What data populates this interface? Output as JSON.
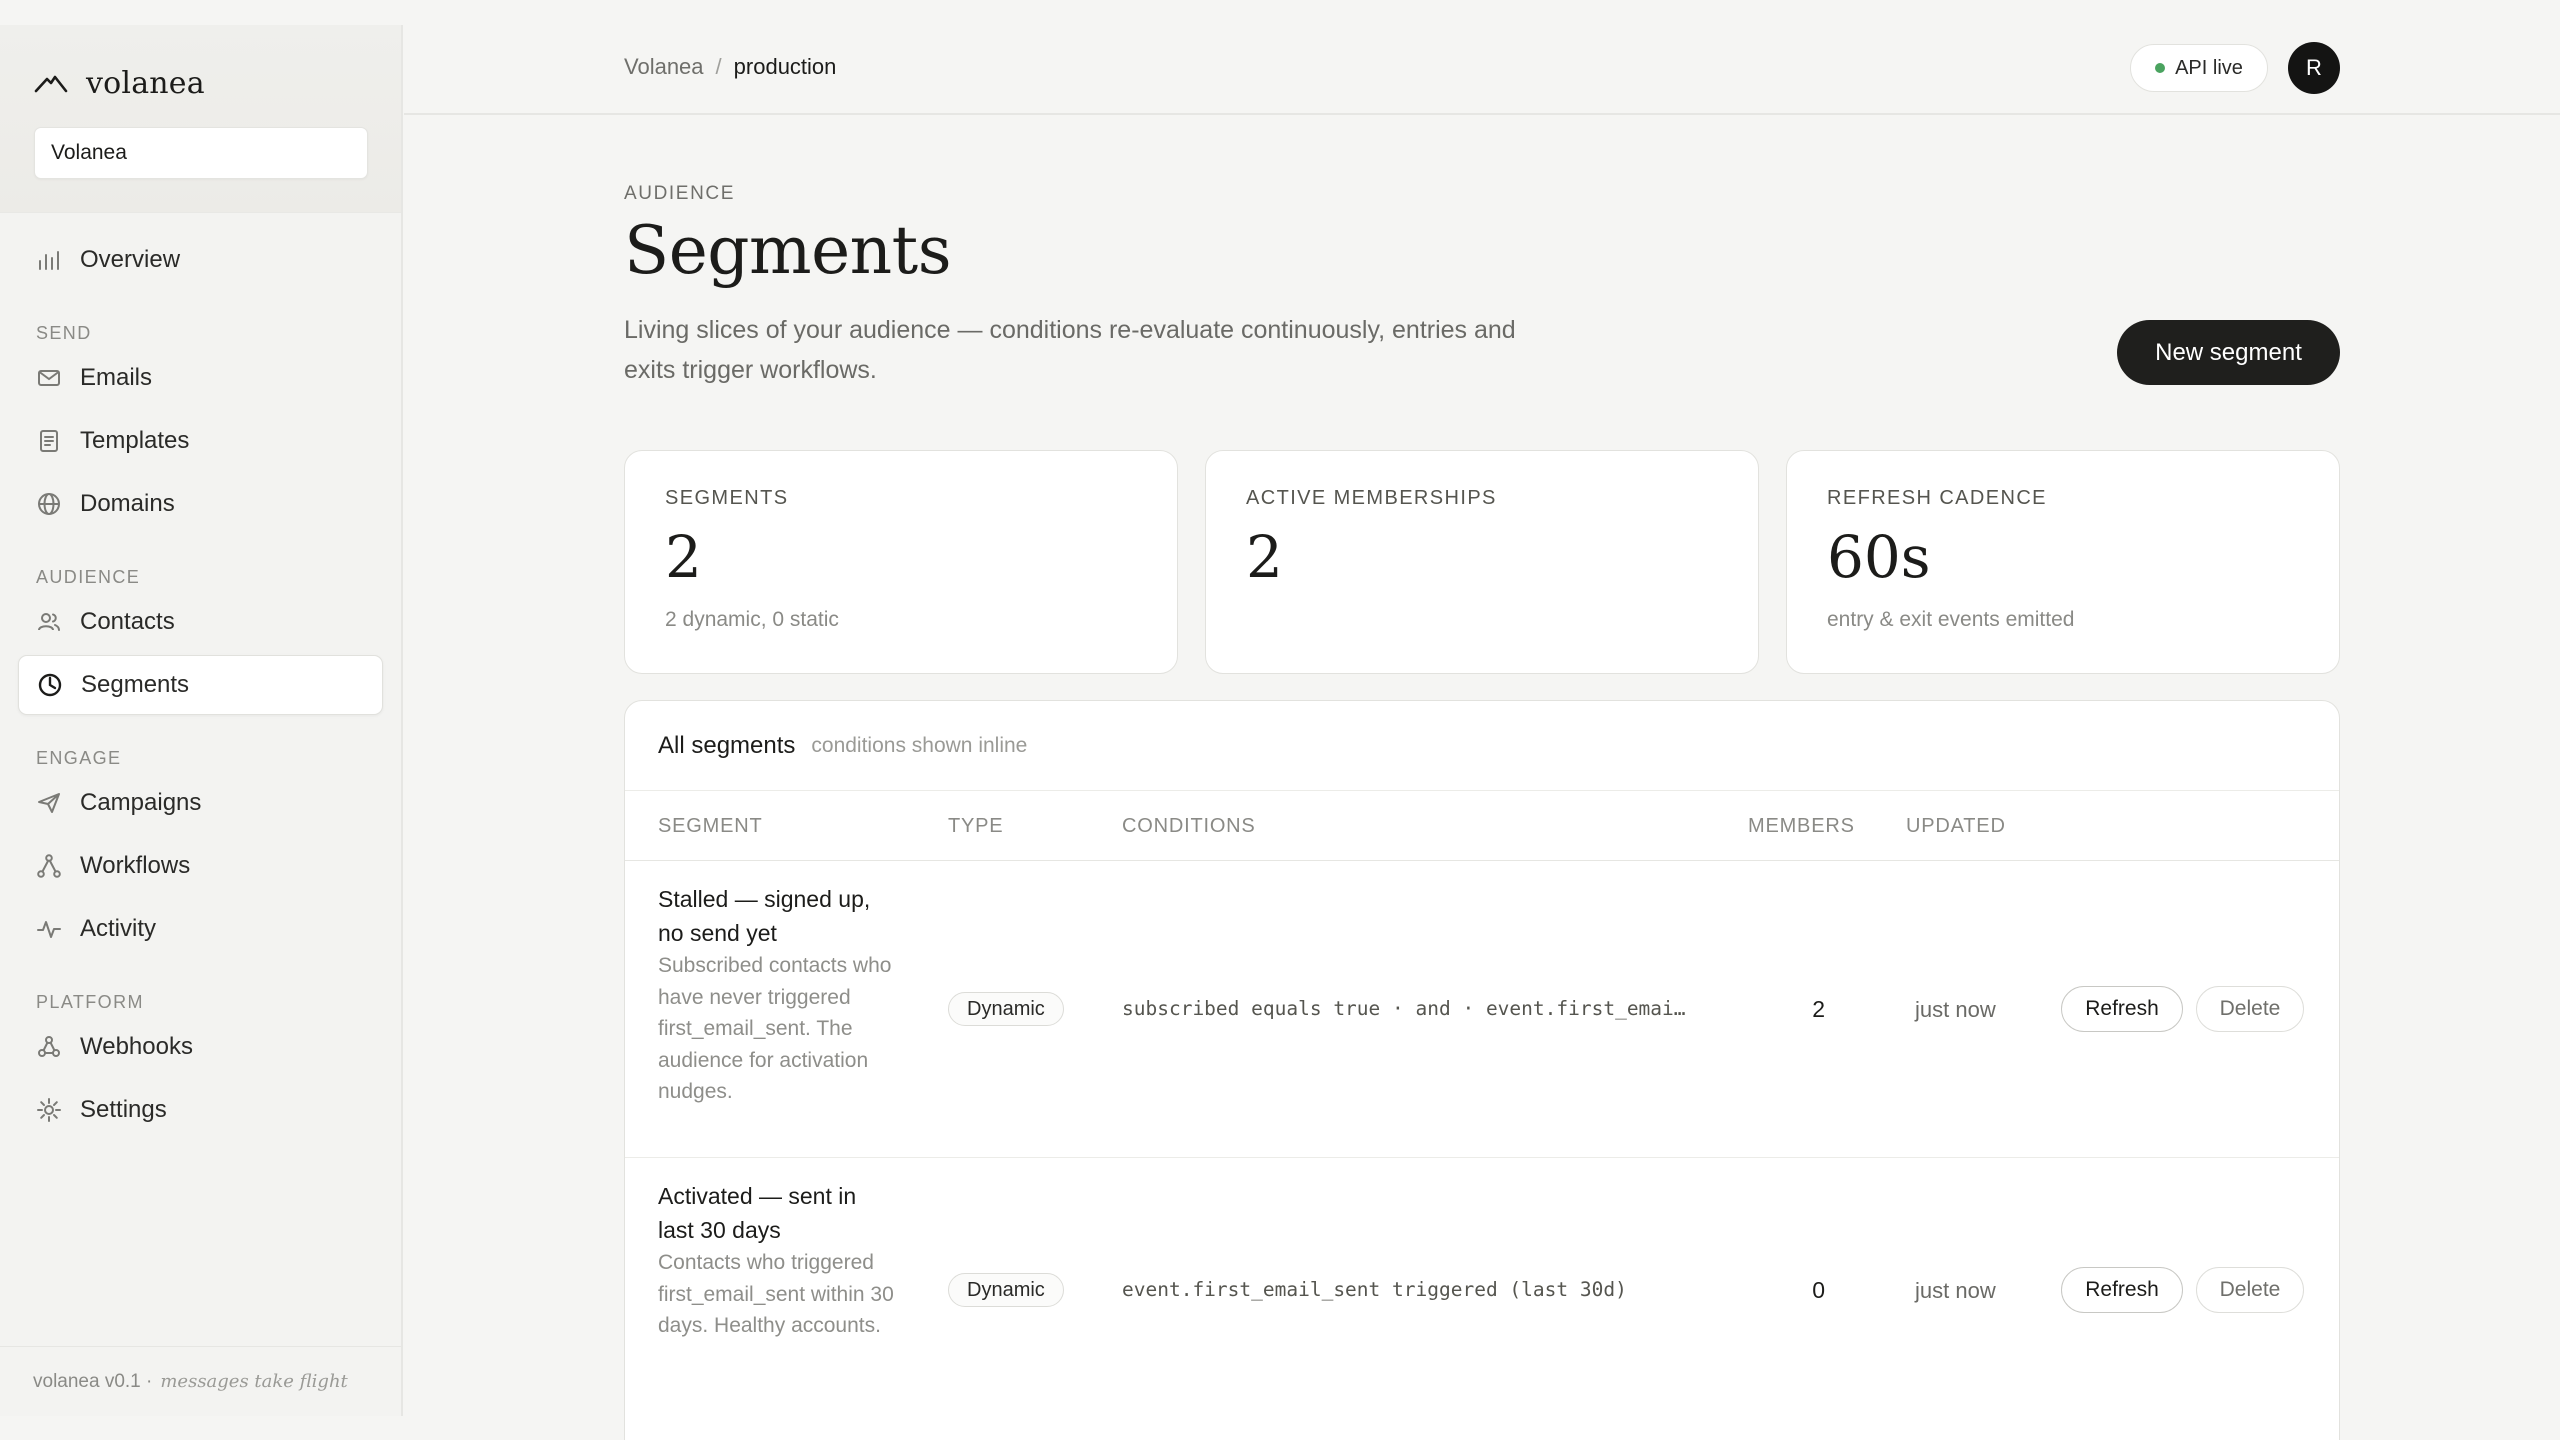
{
  "brand": {
    "name": "volanea",
    "workspace": "Volanea"
  },
  "sidebar": {
    "overview": "Overview",
    "sections": {
      "send": "SEND",
      "audience": "AUDIENCE",
      "engage": "ENGAGE",
      "platform": "PLATFORM"
    },
    "items": {
      "emails": "Emails",
      "templates": "Templates",
      "domains": "Domains",
      "contacts": "Contacts",
      "segments": "Segments",
      "campaigns": "Campaigns",
      "workflows": "Workflows",
      "activity": "Activity",
      "webhooks": "Webhooks",
      "settings": "Settings"
    },
    "active": "segments",
    "footer": {
      "version": "volanea v0.1 ·",
      "tagline": "messages take flight"
    }
  },
  "topbar": {
    "breadcrumb": [
      "Volanea",
      "production"
    ],
    "breadcrumb_sep": "/",
    "api_status": "API live",
    "api_status_color": "#4aa35f",
    "avatar_initial": "R"
  },
  "page": {
    "eyebrow": "AUDIENCE",
    "title": "Segments",
    "description": "Living slices of your audience — conditions re-evaluate continuously, entries and exits trigger workflows.",
    "new_button": "New segment"
  },
  "stats": [
    {
      "label": "SEGMENTS",
      "value": "2",
      "sub": "2 dynamic, 0 static"
    },
    {
      "label": "ACTIVE MEMBERSHIPS",
      "value": "2",
      "sub": ""
    },
    {
      "label": "REFRESH CADENCE",
      "value": "60s",
      "sub": "entry & exit events emitted"
    }
  ],
  "table": {
    "title": "All segments",
    "subtitle": "conditions shown inline",
    "columns": [
      "SEGMENT",
      "TYPE",
      "CONDITIONS",
      "MEMBERS",
      "UPDATED"
    ],
    "rows": [
      {
        "name": "Stalled — signed up, no send yet",
        "description": "Subscribed contacts who have never triggered first_email_sent. The audience for activation nudges.",
        "type": "Dynamic",
        "conditions": "subscribed equals true · and · event.first_email_sent not triggered",
        "members": "2",
        "updated": "just now",
        "refresh": "Refresh",
        "delete": "Delete"
      },
      {
        "name": "Activated — sent in last 30 days",
        "description": "Contacts who triggered first_email_sent within 30 days. Healthy accounts.",
        "type": "Dynamic",
        "conditions": "event.first_email_sent triggered (last 30d)",
        "members": "0",
        "updated": "just now",
        "refresh": "Refresh",
        "delete": "Delete"
      }
    ]
  },
  "colors": {
    "accent_dark": "#1f1f1d",
    "background": "#f5f5f3",
    "card": "#ffffff"
  }
}
